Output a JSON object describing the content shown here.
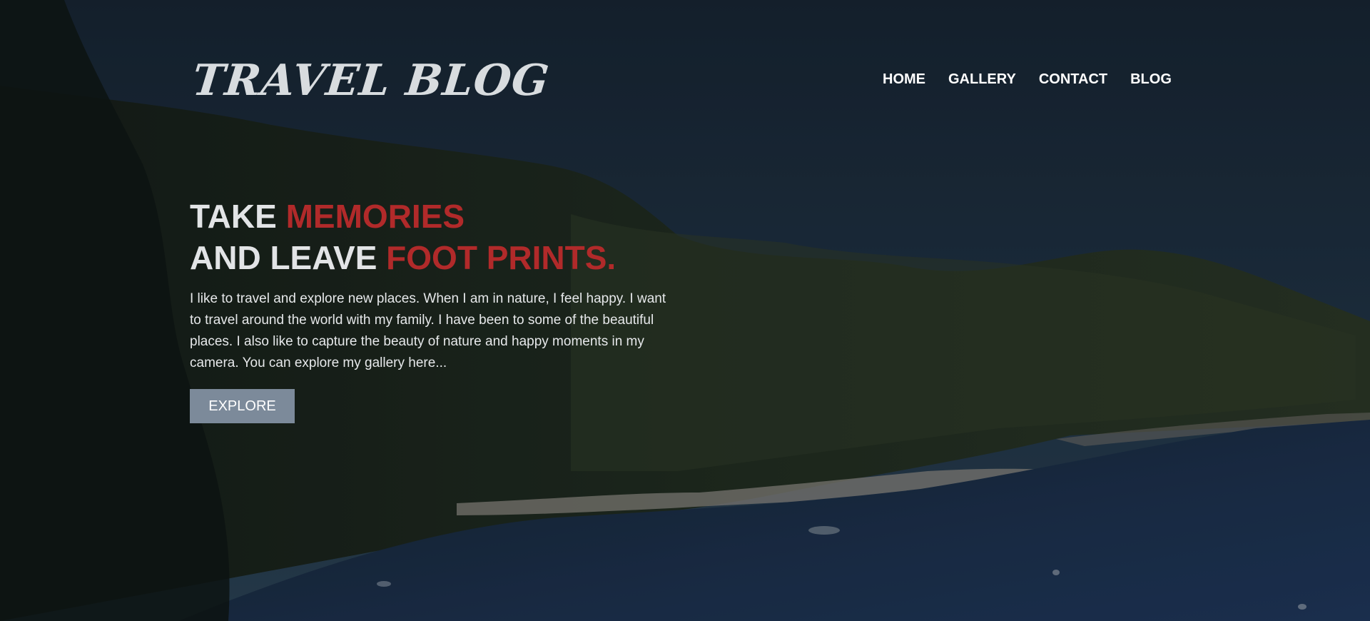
{
  "header": {
    "logo_text": "TRAVEL BLOG",
    "nav": [
      {
        "label": "HOME"
      },
      {
        "label": "GALLERY"
      },
      {
        "label": "CONTACT"
      },
      {
        "label": "BLOG"
      }
    ]
  },
  "hero": {
    "headline": {
      "line1_plain": "TAKE ",
      "line1_accent": "MEMORIES",
      "line2_plain": "AND LEAVE ",
      "line2_accent": "FOOT PRINTS."
    },
    "description": "I like to travel and explore new places. When I am in nature, I feel happy. I want to travel around the world with my family. I have been to some of the beautiful places. I also like to capture the beauty of nature and happy moments in my camera. You can explore my gallery here...",
    "cta_label": "EXPLORE"
  },
  "colors": {
    "accent": "#b12a2a",
    "button": "#7c8a9a",
    "sky": "#1b2c3a",
    "text": "#e2e4e6"
  }
}
